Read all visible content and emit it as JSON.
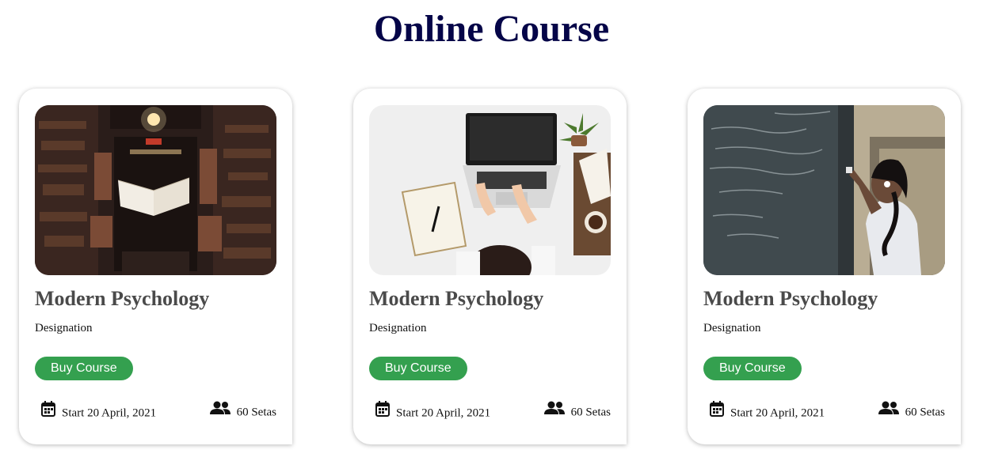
{
  "page": {
    "title": "Online Course"
  },
  "courses": [
    {
      "image": "library-book-photo",
      "title": "Modern Psychology",
      "designation": "Designation",
      "button_label": "Buy Course",
      "start": "Start 20 April, 2021",
      "seats": "60 Setas"
    },
    {
      "image": "laptop-desk-photo",
      "title": "Modern Psychology",
      "designation": "Designation",
      "button_label": "Buy Course",
      "start": "Start 20 April, 2021",
      "seats": "60 Setas"
    },
    {
      "image": "chalkboard-student-photo",
      "title": "Modern Psychology",
      "designation": "Designation",
      "button_label": "Buy Course",
      "start": "Start 20 April, 2021",
      "seats": "60 Setas"
    }
  ],
  "colors": {
    "title": "#050548",
    "button": "#34a04f",
    "card_title": "#4a4a4a"
  },
  "icons": {
    "start": "calendar-icon",
    "seats": "users-icon"
  }
}
